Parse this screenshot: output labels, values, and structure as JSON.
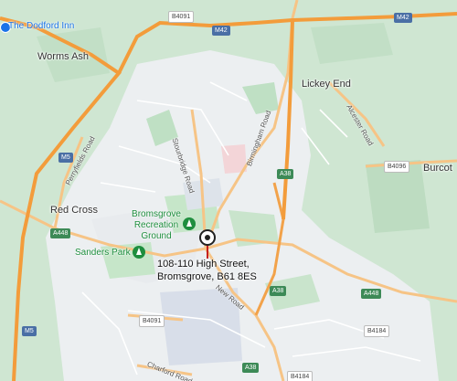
{
  "places": {
    "dodford_inn": "The Dodford Inn",
    "worms_ash": "Worms Ash",
    "lickey_end": "Lickey End",
    "burcot": "Burcot",
    "red_cross": "Red Cross"
  },
  "parks": {
    "sanders_park": "Sanders Park",
    "recreation_ground": "Bromsgrove Recreation Ground"
  },
  "streets": {
    "sourbridge_road": "Stourbridge Road",
    "birmingham_road": "Birmingham Road",
    "alcester_road": "Alcester Road",
    "perryfields_road": "Perryfields Road",
    "new_road": "New Road",
    "charford_road": "Charford Road"
  },
  "shields": {
    "b4091_top": "B4091",
    "m42_left": "M42",
    "m42_right": "M42",
    "m5_upper": "M5",
    "m5_lower": "M5",
    "b4096": "B4096",
    "a448_left": "A448",
    "a448_right": "A448",
    "a38_upper": "A38",
    "a38_mid": "A38",
    "a38_lower": "A38",
    "b4091_bottom": "B4091",
    "b4184_right": "B4184",
    "b4184_bottom": "B4184"
  },
  "marker": {
    "address_line1": "108-110 High Street,",
    "address_line2": "Bromsgrove, B61 8ES"
  },
  "colors": {
    "countryside": "#cfe6d2",
    "urban": "#eef0f1",
    "motorway": "#f2a24a",
    "a_road": "#f6b26b",
    "marker": "#c5221f"
  }
}
